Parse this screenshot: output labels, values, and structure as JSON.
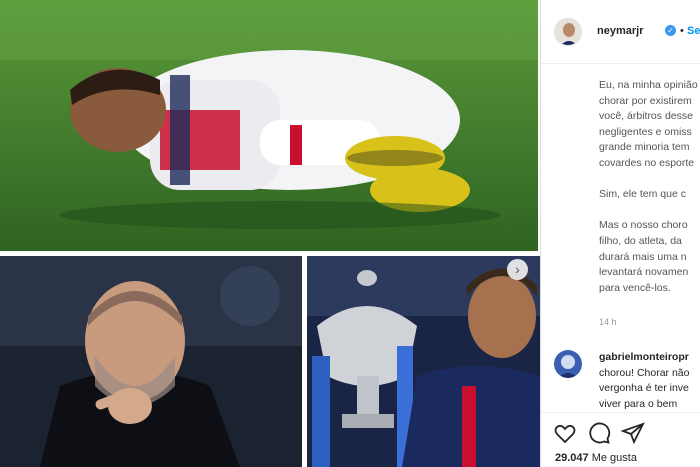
{
  "post": {
    "username": "neymarjr",
    "dot": "•",
    "follow_label": "Seguir",
    "caption_lines": [
      "Eu, na minha opinião",
      "chorar por existirem",
      "você, árbitros desse",
      "negligentes e omiss",
      "grande minoria tem",
      "covardes no esporte",
      "",
      "Sim, ele tem que c",
      "",
      "Mas o nosso choro",
      "filho, do atleta, da",
      "durará mais uma n",
      "levantará novamen",
      "para vencê-los."
    ],
    "time": "14 h"
  },
  "comment": {
    "username": "gabrielmonteiropr",
    "lines": [
      "chorou! Chorar não",
      "vergonha é ter inve",
      "viver para o bem"
    ]
  },
  "actions": {
    "like_icon": "heart-icon",
    "comment_icon": "comment-icon",
    "share_icon": "paper-plane-icon"
  },
  "likes": {
    "count": "29.047",
    "label": "Me gusta"
  },
  "colors": {
    "accent": "#0095f6",
    "verified": "#3897f0",
    "pitch_green": "#3f7a2a"
  }
}
